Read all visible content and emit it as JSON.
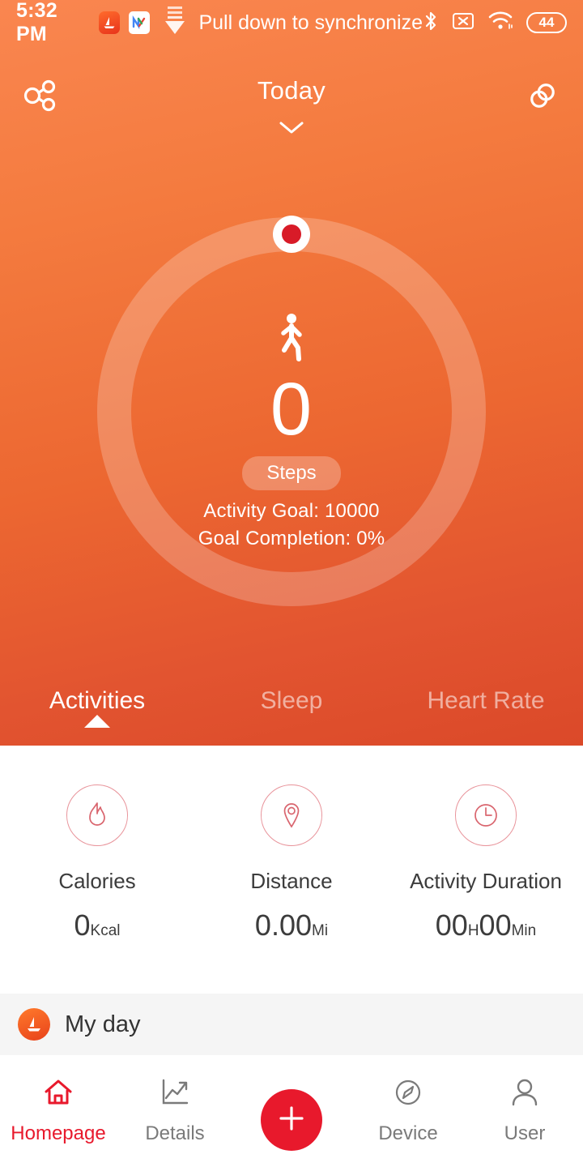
{
  "statusbar": {
    "time": "5:32 PM",
    "sync_text": "Pull down to synchronize",
    "battery_level": "44",
    "icons": [
      "boat-app-icon",
      "notes-app-icon",
      "sync-down-arrow-icon",
      "bluetooth-icon",
      "no-sim-icon",
      "wifi-icon",
      "battery-icon"
    ]
  },
  "appbar": {
    "title": "Today",
    "share_icon": "share-icon",
    "chevron_icon": "chevron-down-icon",
    "link_icon": "chain-link-icon"
  },
  "ring": {
    "walk_icon": "walking-person-icon",
    "steps_value": "0",
    "steps_label": "Steps",
    "activity_goal": "Activity Goal: 10000",
    "goal_completion": "Goal Completion: 0%",
    "progress_percent": 0
  },
  "tabs": [
    {
      "label": "Activities",
      "active": true
    },
    {
      "label": "Sleep",
      "active": false
    },
    {
      "label": "Heart Rate",
      "active": false
    }
  ],
  "stats": [
    {
      "icon": "flame-icon",
      "label": "Calories",
      "value": "0",
      "unit": "Kcal"
    },
    {
      "icon": "location-pin-icon",
      "label": "Distance",
      "value": "0.00",
      "unit": "Mi"
    },
    {
      "icon": "clock-icon",
      "label": "Activity Duration",
      "value": "00",
      "unit": "H",
      "value2": "00",
      "unit2": "Min"
    }
  ],
  "myday": {
    "icon": "boat-app-icon",
    "label": "My day"
  },
  "bottomnav": [
    {
      "label": "Homepage",
      "icon": "home-icon",
      "active": true
    },
    {
      "label": "Details",
      "icon": "chart-icon",
      "active": false
    },
    {
      "label": "Device",
      "icon": "compass-icon",
      "active": false
    },
    {
      "label": "User",
      "icon": "person-icon",
      "active": false
    }
  ],
  "fab": {
    "icon": "plus-icon"
  },
  "colors": {
    "brand_orange": "#EC6731",
    "accent_red": "#E8192C",
    "ring_knob_red": "#D81B28",
    "stat_outline": "#E8939A",
    "band_gray": "#F5F5F5"
  }
}
